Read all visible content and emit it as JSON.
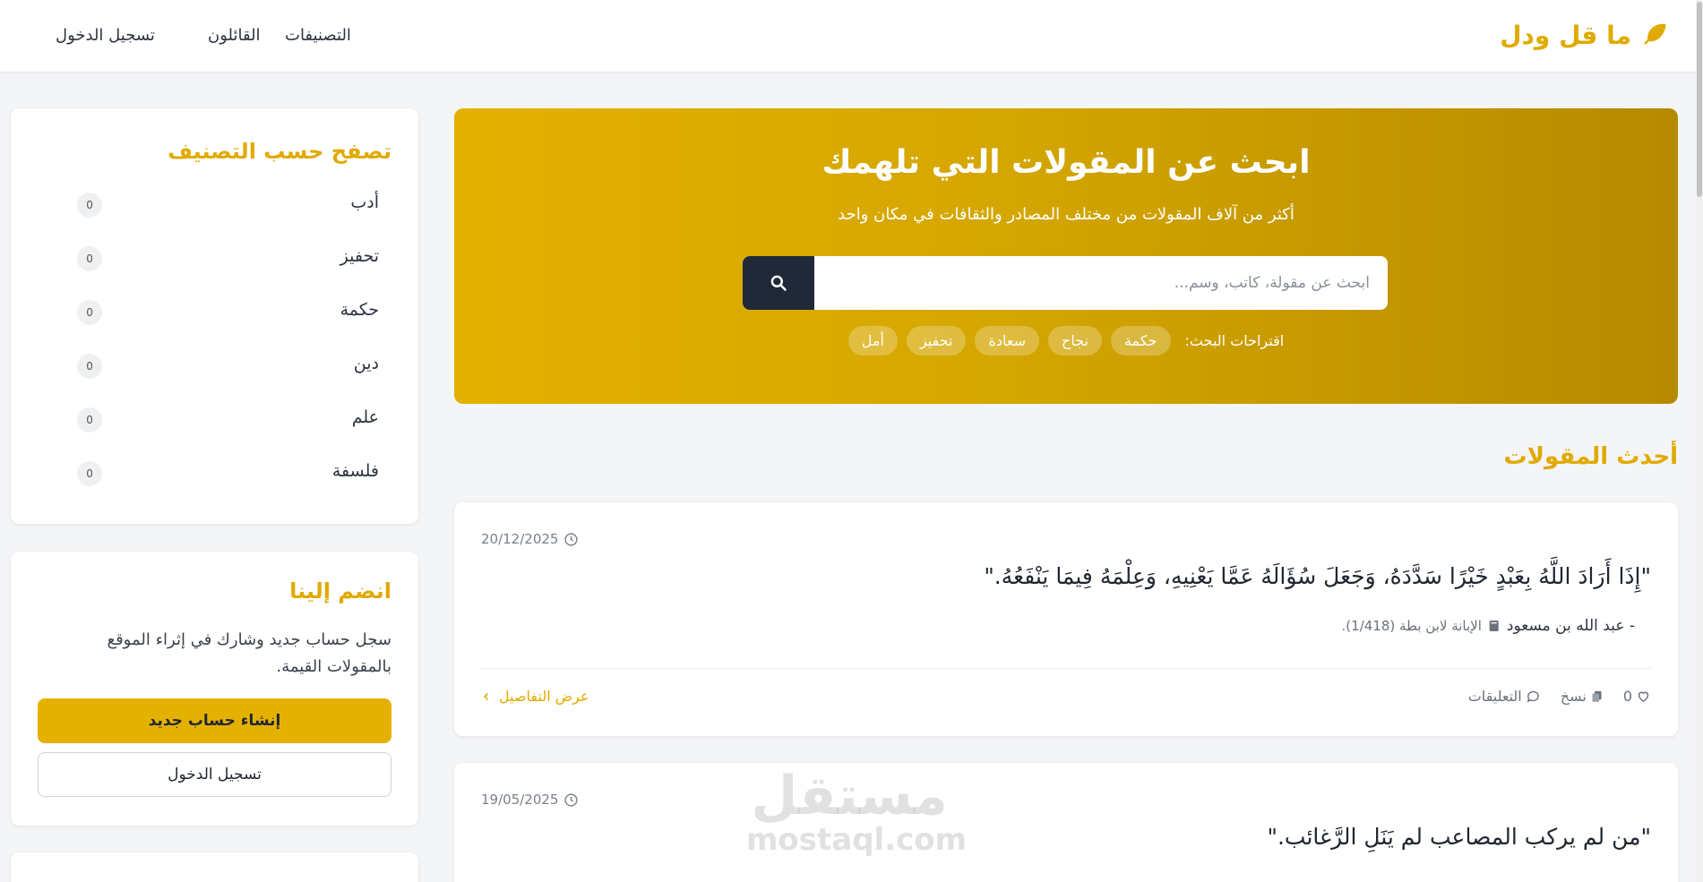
{
  "brand": {
    "name": "ما قل ودل",
    "icon": "feather-icon"
  },
  "nav": {
    "categories": "التصنيفات",
    "authors": "القائلون",
    "login": "تسجيل الدخول"
  },
  "hero": {
    "title": "ابحث عن المقولات التي تلهمك",
    "subtitle": "أكثر من آلاف المقولات من مختلف المصادر والثقافات في مكان واحد",
    "search_placeholder": "ابحث عن مقولة، كاتب، وسم...",
    "suggestions_label": "اقتراحات البحث:",
    "suggestions": [
      "حكمة",
      "نجاح",
      "سعادة",
      "تحفيز",
      "أمل"
    ]
  },
  "latest": {
    "title": "أحدث المقولات",
    "quotes": [
      {
        "date": "20/12/2025",
        "text": "\"إِذَا أَرَادَ اللَّهُ بِعَبْدٍ خَيْرًا سَدَّدَهُ، وَجَعَلَ سُؤَالَهُ عَمَّا يَعْنِيهِ، وَعِلْمَهُ فِيمَا يَنْفَعُهُ.\"",
        "author": "- عبد الله بن مسعود",
        "source": "الإبانة لابن بطة (1/418).",
        "likes": "0",
        "copies_label": "نسخ",
        "comments_label": "التعليقات",
        "details_label": "عرض التفاصيل"
      },
      {
        "date": "19/05/2025",
        "text": "\"من لم يركب المصاعب لم يَنَلِ الرَّغائب.\""
      }
    ]
  },
  "sidebar": {
    "categories_title": "تصفح حسب التصنيف",
    "categories": [
      {
        "name": "أدب",
        "count": "0"
      },
      {
        "name": "تحفيز",
        "count": "0"
      },
      {
        "name": "حكمة",
        "count": "0"
      },
      {
        "name": "دين",
        "count": "0"
      },
      {
        "name": "علم",
        "count": "0"
      },
      {
        "name": "فلسفة",
        "count": "0"
      }
    ],
    "join_title": "انضم إلينا",
    "join_text": "سجل حساب جديد وشارك في إثراء الموقع بالمقولات القيمة.",
    "register_button": "إنشاء حساب جديد",
    "login_button": "تسجيل الدخول"
  },
  "watermark": {
    "arabic": "مستقل",
    "latin": "mostaql.com"
  },
  "colors": {
    "accent": "#e0aa00",
    "dark": "#1f2937",
    "hero_start": "#e4b100",
    "hero_end": "#b68a00"
  }
}
